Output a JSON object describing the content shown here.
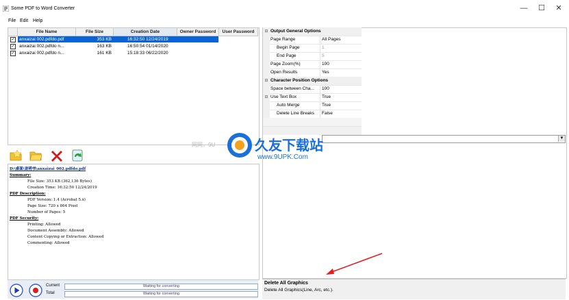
{
  "window": {
    "title": "Some PDF to Word Converter",
    "minimize_glyph": "—",
    "maximize_glyph": "☐",
    "close_glyph": "✕"
  },
  "menu": [
    "File",
    "Edit",
    "Help"
  ],
  "file_table": {
    "columns": [
      "File Name",
      "File Size",
      "Creation Date",
      "Owner Password",
      "User Password"
    ],
    "rows": [
      {
        "checked": true,
        "name": "anxaizai 002.pdfdo.pdf",
        "size": "353 KB",
        "date": "16:32:50 12/24/2019",
        "owner_password": "",
        "user_password": "",
        "selected": true
      },
      {
        "checked": true,
        "name": "anxaizai 002.pdfdo n...",
        "size": "163 KB",
        "date": "16:50:54 01/14/2020",
        "owner_password": "",
        "user_password": "",
        "selected": false
      },
      {
        "checked": true,
        "name": "anxaizai 002.pdfdo n...",
        "size": "161 KB",
        "date": "15:18:33 06/22/2020",
        "owner_password": "",
        "user_password": "",
        "selected": false
      }
    ]
  },
  "toolbar": {
    "icons": [
      "add-file-icon",
      "open-folder-icon",
      "delete-icon",
      "refresh-icon"
    ]
  },
  "info_panel": {
    "path": "D:\\桌面\\说明书\\anxaizai_002.pdfdo.pdf",
    "summary_heading": "Summary:",
    "file_size": "File Size: 353 KB (362,136 Bytes)",
    "creation_time": "Creation Time: 16:32:50 12/24/2019",
    "pdf_desc_heading": "PDF Description:",
    "pdf_version": "PDF Version: 1.4 (Acrobat 5.x)",
    "page_size": "Page Size: 720 x 864 Pixel",
    "num_pages": "Number of Pages: 5",
    "security_heading": "PDF Security:",
    "printing": "Printing: Allowed",
    "assembly": "Document Assembly: Allowed",
    "copying": "Content Copying or Extraction: Allowed",
    "commenting": "Commenting: Allowed"
  },
  "status": {
    "current_label": "Current",
    "total_label": "Total",
    "current_text": "Waiting for converting",
    "total_text": "Waiting for converting"
  },
  "properties": [
    {
      "type": "category",
      "gutter": "⊟",
      "name": "Output General Options"
    },
    {
      "type": "item",
      "name": "Page Range",
      "value": "All Pages",
      "indent": false
    },
    {
      "type": "item",
      "name": "Begin Page",
      "value": "1",
      "indent": true,
      "dim": true
    },
    {
      "type": "item",
      "name": "End Page",
      "value": "5",
      "indent": true,
      "dim": true
    },
    {
      "type": "item",
      "name": "Page Zoom(%)",
      "value": "100",
      "indent": false
    },
    {
      "type": "item",
      "name": "Open Results",
      "value": "Yes",
      "indent": false
    },
    {
      "type": "category",
      "gutter": "⊟",
      "name": "Character Position Options"
    },
    {
      "type": "item",
      "name": "Space between Cha...",
      "value": "100",
      "indent": false
    },
    {
      "type": "item",
      "name": "Use Text Box",
      "value": "True",
      "indent": false,
      "gutter": "⊟"
    },
    {
      "type": "item",
      "name": "Auto Merge",
      "value": "True",
      "indent": true
    },
    {
      "type": "item",
      "name": "Delete Line Breaks",
      "value": "False",
      "indent": true
    }
  ],
  "description": {
    "title": "Delete All Graphics",
    "text": "Delete All Graphics(Line, Arc, etc.)."
  },
  "watermark": {
    "title": "久友下载站",
    "url": "www.9UPK.Com",
    "left_text": "网网，9U"
  },
  "colors": {
    "selection": "#0a64d8",
    "arrow": "#e02020",
    "status_bg": "#e9eef6"
  }
}
